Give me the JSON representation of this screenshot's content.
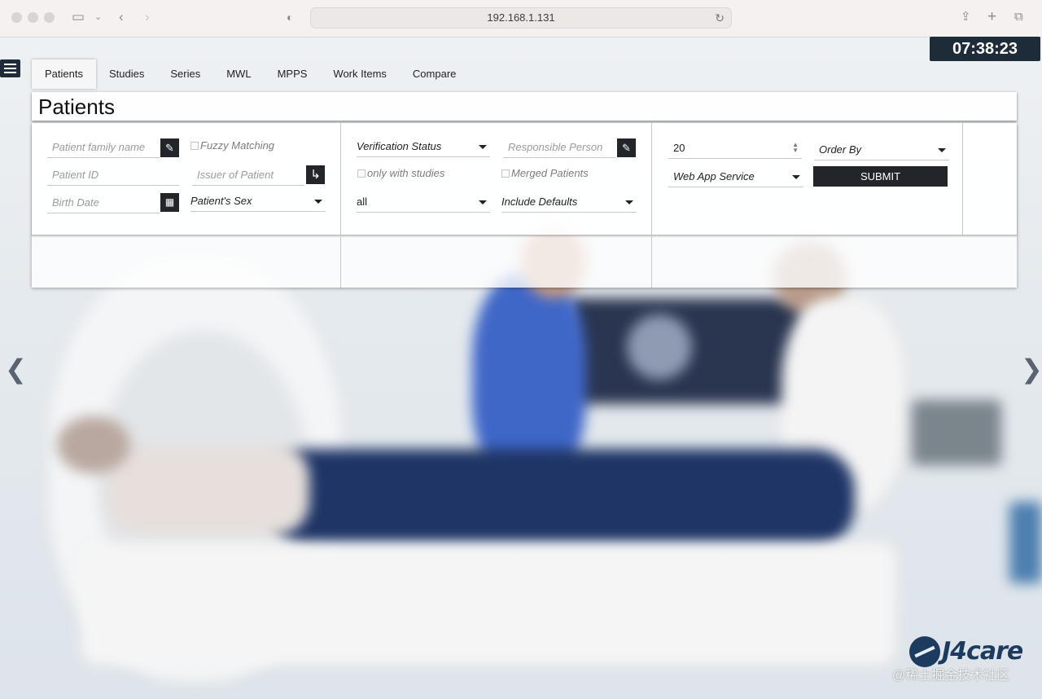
{
  "browser": {
    "address": "192.168.1.131"
  },
  "clock": "07:38:23",
  "tabs": [
    {
      "label": "Patients",
      "active": true
    },
    {
      "label": "Studies"
    },
    {
      "label": "Series"
    },
    {
      "label": "MWL"
    },
    {
      "label": "MPPS"
    },
    {
      "label": "Work Items"
    },
    {
      "label": "Compare"
    }
  ],
  "page_title": "Patients",
  "filters": {
    "patient_family_name": {
      "placeholder": "Patient family name"
    },
    "fuzzy_matching": {
      "label": "Fuzzy Matching",
      "checked": false
    },
    "patient_id": {
      "placeholder": "Patient ID"
    },
    "issuer_of_patient": {
      "placeholder": "Issuer of Patient"
    },
    "birth_date": {
      "placeholder": "Birth Date"
    },
    "patient_sex": {
      "value": "Patient's Sex"
    },
    "verification_status": {
      "value": "Verification Status"
    },
    "responsible_person": {
      "placeholder": "Responsible Person"
    },
    "only_with_studies": {
      "label": "only with studies",
      "checked": false
    },
    "merged_patients": {
      "label": "Merged Patients",
      "checked": false
    },
    "scope": {
      "value": "all"
    },
    "include_defaults": {
      "value": "Include Defaults"
    },
    "limit": {
      "value": "20"
    },
    "order_by": {
      "value": "Order By"
    },
    "service": {
      "value": "Web App Service"
    },
    "submit_label": "SUBMIT"
  },
  "logo": {
    "text": "J4care"
  },
  "watermark": "@稀土掘金技术社区",
  "icons": {
    "edit": "pencil-icon",
    "issuer": "arrow-turn-icon",
    "calendar": "calendar-icon",
    "prev": "chevron-left-icon",
    "next": "chevron-right-icon",
    "menu": "hamburger-icon"
  }
}
